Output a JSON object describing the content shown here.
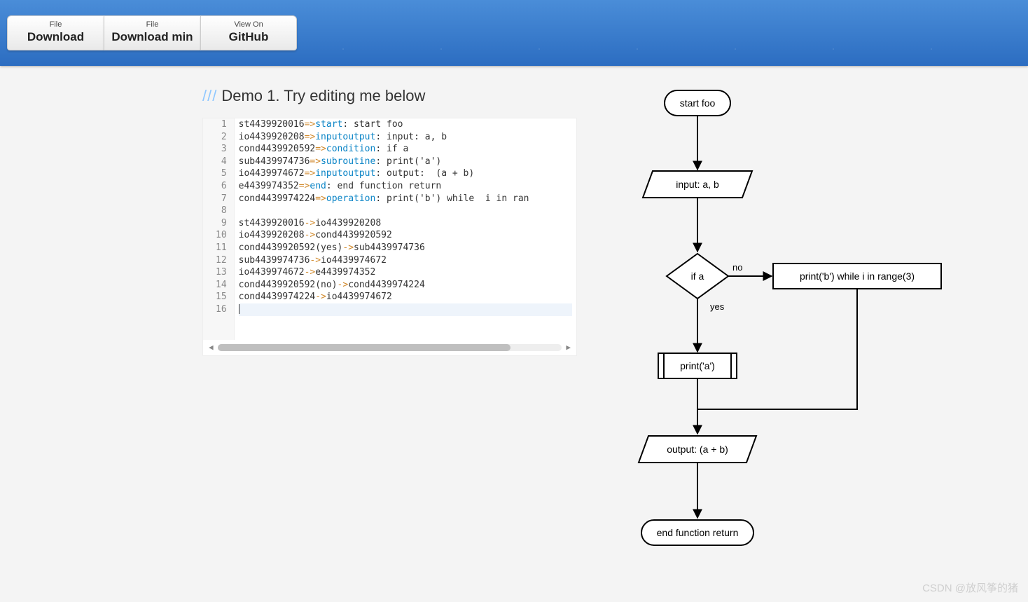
{
  "header": {
    "buttons": [
      {
        "top": "File",
        "bot": "Download"
      },
      {
        "top": "File",
        "bot": "Download min"
      },
      {
        "top": "View On",
        "bot": "GitHub"
      }
    ]
  },
  "demo": {
    "slashes": "///",
    "title": "Demo 1. Try editing me below"
  },
  "editor": {
    "line_count": 16,
    "lines": [
      {
        "n": 1,
        "pre": "st4439920016",
        "op": "=>",
        "kw": "start",
        "post": ": start foo"
      },
      {
        "n": 2,
        "pre": "io4439920208",
        "op": "=>",
        "kw": "inputoutput",
        "post": ": input: a, b"
      },
      {
        "n": 3,
        "pre": "cond4439920592",
        "op": "=>",
        "kw": "condition",
        "post": ": if a"
      },
      {
        "n": 4,
        "pre": "sub4439974736",
        "op": "=>",
        "kw": "subroutine",
        "post": ": print('a')"
      },
      {
        "n": 5,
        "pre": "io4439974672",
        "op": "=>",
        "kw": "inputoutput",
        "post": ": output:  (a + b)"
      },
      {
        "n": 6,
        "pre": "e4439974352",
        "op": "=>",
        "kw": "end",
        "post": ": end function return"
      },
      {
        "n": 7,
        "pre": "cond4439974224",
        "op": "=>",
        "kw": "operation",
        "post": ": print('b') while  i in ran"
      },
      {
        "n": 8,
        "raw": ""
      },
      {
        "n": 9,
        "pre": "st4439920016",
        "op": "->",
        "post2": "io4439920208"
      },
      {
        "n": 10,
        "pre": "io4439920208",
        "op": "->",
        "post2": "cond4439920592"
      },
      {
        "n": 11,
        "pre": "cond4439920592(yes)",
        "op": "->",
        "post2": "sub4439974736"
      },
      {
        "n": 12,
        "pre": "sub4439974736",
        "op": "->",
        "post2": "io4439974672"
      },
      {
        "n": 13,
        "pre": "io4439974672",
        "op": "->",
        "post2": "e4439974352"
      },
      {
        "n": 14,
        "pre": "cond4439920592(no)",
        "op": "->",
        "post2": "cond4439974224"
      },
      {
        "n": 15,
        "pre": "cond4439974224",
        "op": "->",
        "post2": "io4439974672"
      },
      {
        "n": 16,
        "raw": "",
        "active": true
      }
    ]
  },
  "flowchart": {
    "nodes": {
      "start": "start foo",
      "input": "input: a, b",
      "cond": "if a",
      "cond_yes": "yes",
      "cond_no": "no",
      "sub": "print('a')",
      "op": "print('b') while i in range(3)",
      "output": "output: (a + b)",
      "end": "end function return"
    }
  },
  "watermark": "CSDN @放风筝的猪"
}
